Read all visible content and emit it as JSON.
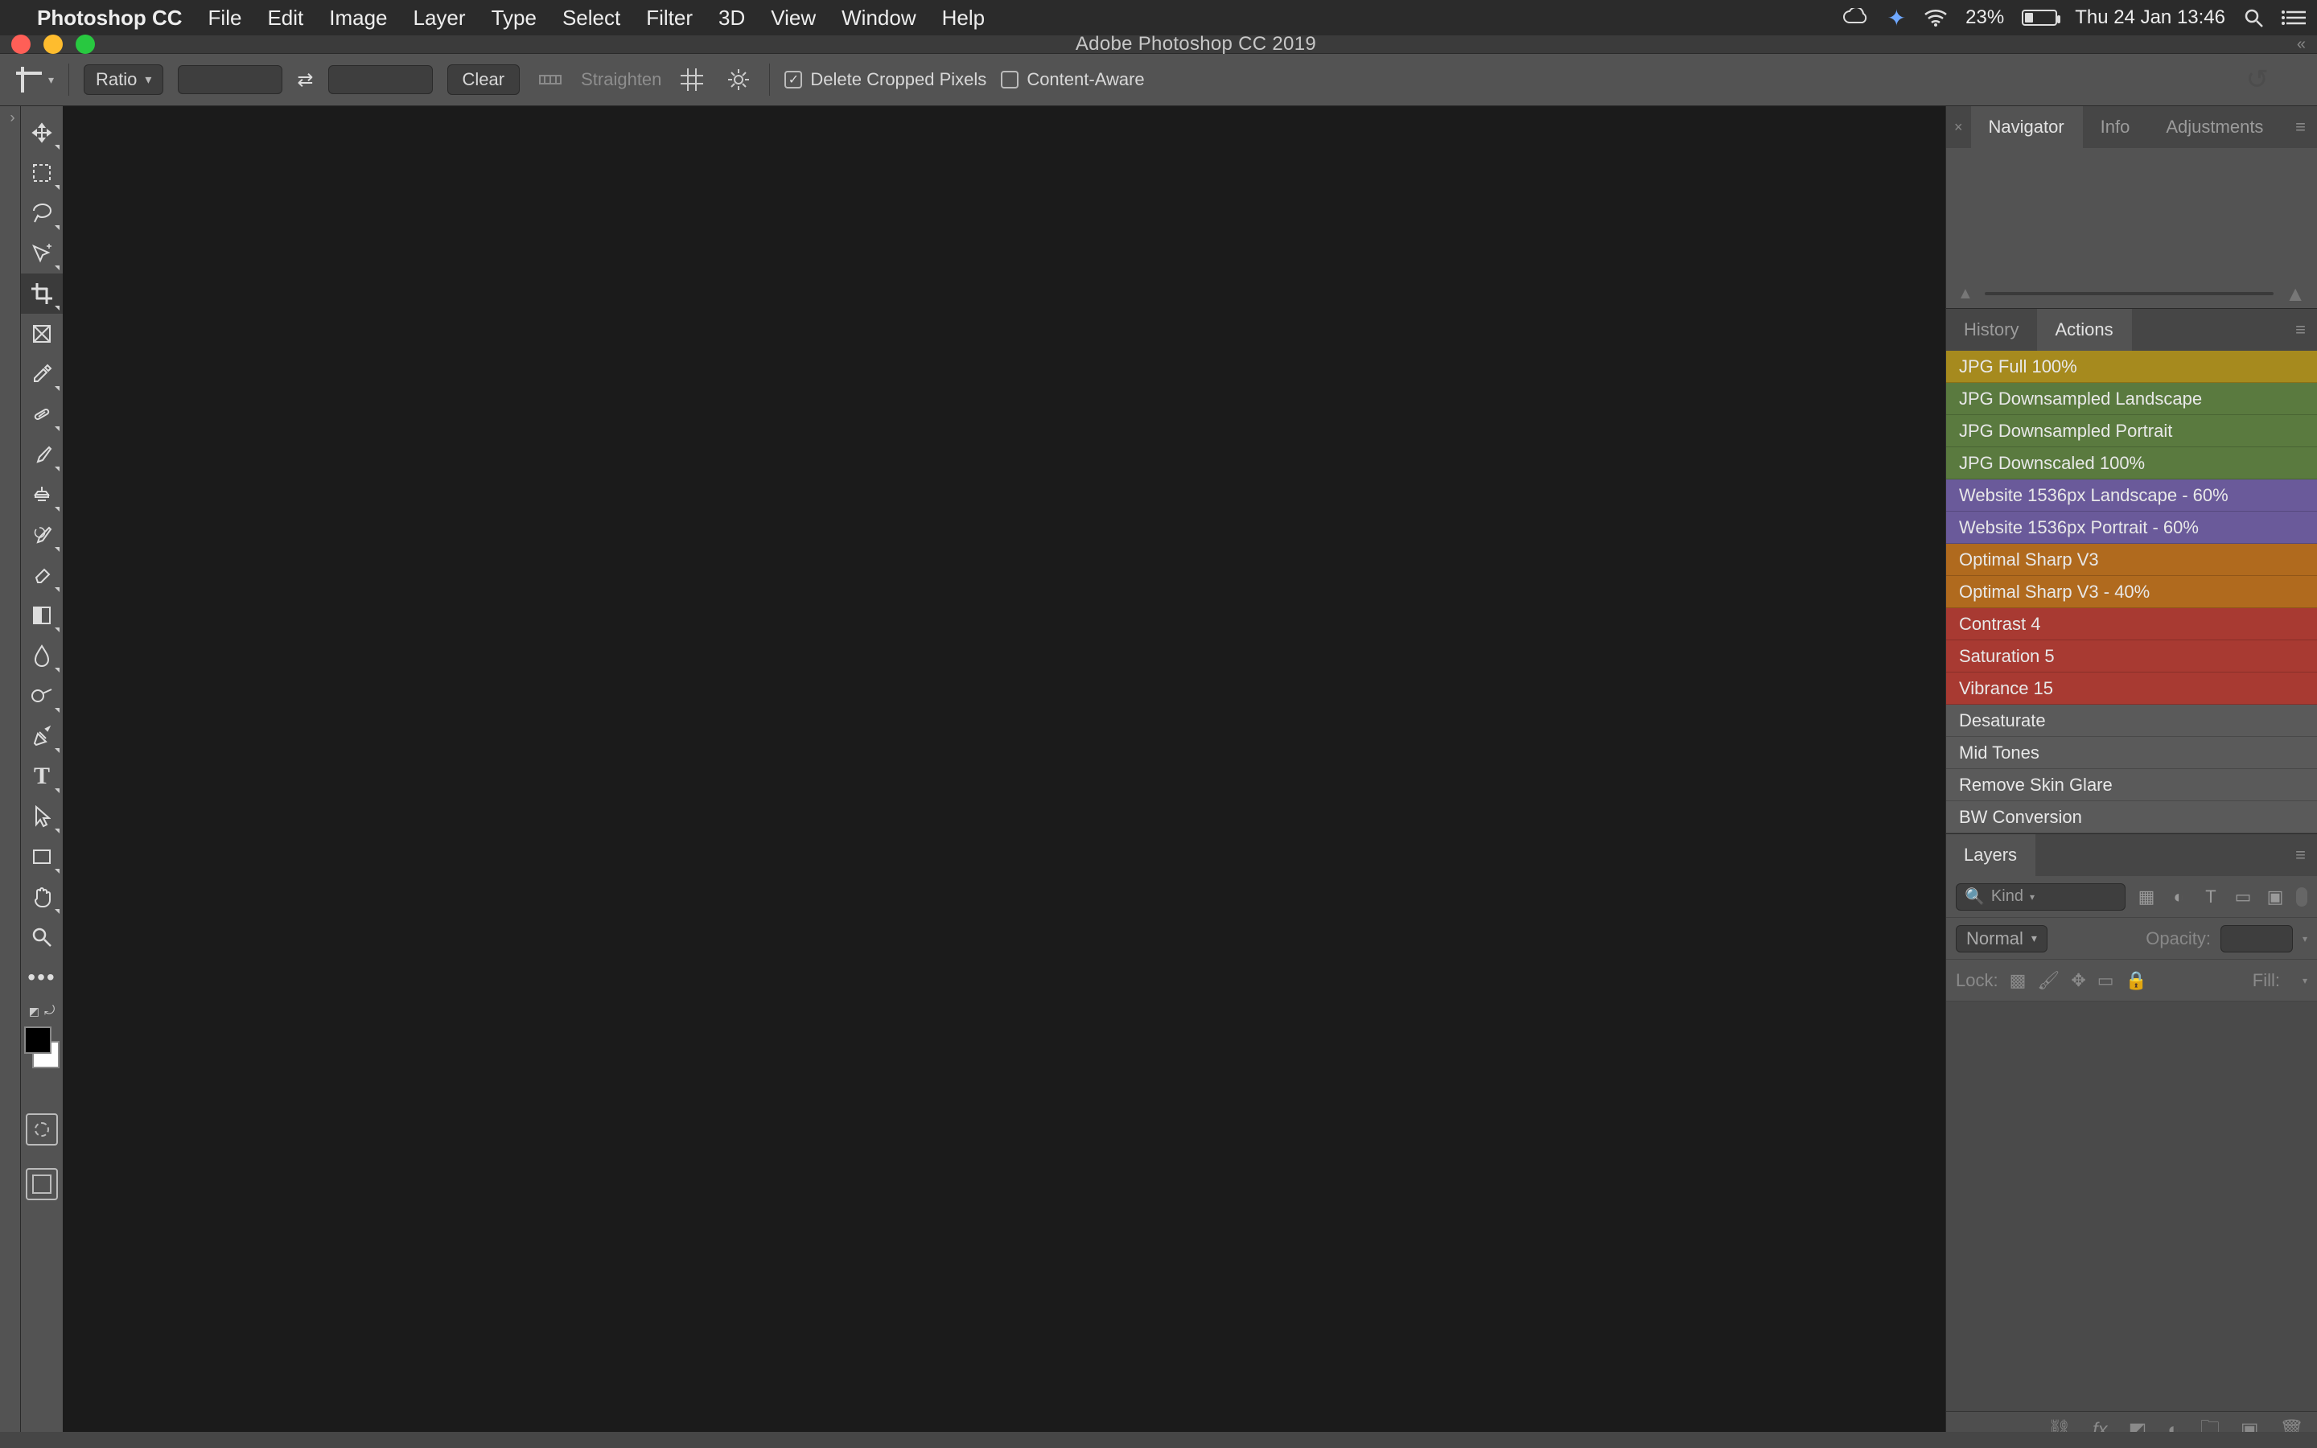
{
  "menubar": {
    "apple": "",
    "app_name": "Photoshop CC",
    "items": [
      "File",
      "Edit",
      "Image",
      "Layer",
      "Type",
      "Select",
      "Filter",
      "3D",
      "View",
      "Window",
      "Help"
    ],
    "status": {
      "battery_pct": "23%",
      "datetime": "Thu 24 Jan  13:46"
    }
  },
  "window": {
    "title": "Adobe Photoshop CC 2019"
  },
  "options_bar": {
    "ratio_label": "Ratio",
    "clear_label": "Clear",
    "straighten_label": "Straighten",
    "delete_cropped_label": "Delete Cropped Pixels",
    "delete_cropped_checked": true,
    "content_aware_label": "Content-Aware",
    "content_aware_checked": false
  },
  "panels": {
    "nav_tabs": [
      "Navigator",
      "Info",
      "Adjustments"
    ],
    "nav_active": 0,
    "hist_tabs": [
      "History",
      "Actions"
    ],
    "hist_active": 1,
    "actions": [
      {
        "label": "JPG Full 100%",
        "color": "c-yellow"
      },
      {
        "label": "JPG Downsampled Landscape",
        "color": "c-green"
      },
      {
        "label": "JPG Downsampled Portrait",
        "color": "c-green"
      },
      {
        "label": "JPG Downscaled 100%",
        "color": "c-green"
      },
      {
        "label": "Website 1536px Landscape - 60%",
        "color": "c-purple"
      },
      {
        "label": "Website 1536px Portrait - 60%",
        "color": "c-purple"
      },
      {
        "label": "Optimal Sharp V3",
        "color": "c-orange"
      },
      {
        "label": "Optimal Sharp V3 - 40%",
        "color": "c-orange"
      },
      {
        "label": "Contrast 4",
        "color": "c-red"
      },
      {
        "label": "Saturation 5",
        "color": "c-red"
      },
      {
        "label": "Vibrance 15",
        "color": "c-red"
      },
      {
        "label": "Desaturate",
        "color": "c-gray"
      },
      {
        "label": "Mid Tones",
        "color": "c-gray"
      },
      {
        "label": "Remove Skin Glare",
        "color": "c-gray"
      },
      {
        "label": "BW Conversion",
        "color": "c-gray"
      }
    ],
    "layers_tab": "Layers",
    "layers": {
      "filter_kind": "Kind",
      "blend_mode": "Normal",
      "opacity_label": "Opacity:",
      "lock_label": "Lock:",
      "fill_label": "Fill:"
    }
  },
  "tools": [
    "move-tool",
    "marquee-tool",
    "lasso-tool",
    "quick-select-tool",
    "crop-tool",
    "frame-tool",
    "eyedropper-tool",
    "healing-brush-tool",
    "brush-tool",
    "clone-stamp-tool",
    "history-brush-tool",
    "eraser-tool",
    "gradient-tool",
    "blur-tool",
    "dodge-tool",
    "pen-tool",
    "type-tool",
    "path-select-tool",
    "rectangle-tool",
    "hand-tool",
    "zoom-tool",
    "edit-toolbar"
  ],
  "active_tool_index": 4
}
